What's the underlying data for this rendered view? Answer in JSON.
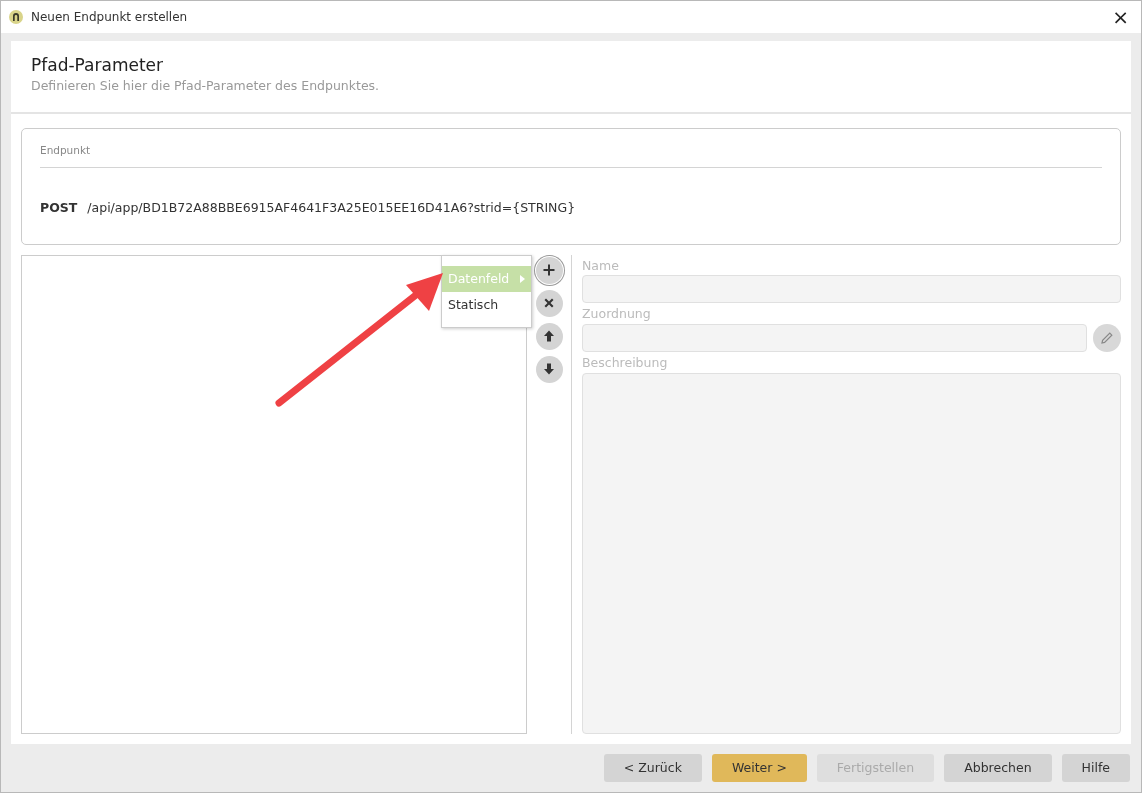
{
  "window": {
    "title": "Neuen Endpunkt erstellen",
    "close": "×"
  },
  "header": {
    "title": "Pfad-Parameter",
    "subtitle": "Definieren Sie hier die Pfad-Parameter des Endpunktes."
  },
  "endpoint": {
    "legend": "Endpunkt",
    "method": "POST",
    "path": "/api/app/BD1B72A88BBE6915AF4641F3A25E015EE16D41A6?strid={STRING}"
  },
  "menu": [
    {
      "label": "Datenfeld",
      "selected": true,
      "submenu": true
    },
    {
      "label": "Statisch",
      "selected": false,
      "submenu": false
    }
  ],
  "tools": [
    {
      "kind": "add",
      "focused": true
    },
    {
      "kind": "remove",
      "focused": false
    },
    {
      "kind": "up",
      "focused": false
    },
    {
      "kind": "down",
      "focused": false
    }
  ],
  "fields": [
    {
      "label": "Name",
      "kind": "text",
      "disabled": true
    },
    {
      "label": "Zuordnung",
      "kind": "edit",
      "disabled": true
    },
    {
      "label": "Beschreibung",
      "kind": "area",
      "disabled": true
    }
  ],
  "buttons": [
    {
      "label": "< Zurück",
      "kind": "default",
      "disabled": false
    },
    {
      "label": "Weiter >",
      "kind": "primary",
      "disabled": false
    },
    {
      "label": "Fertigstellen",
      "kind": "default",
      "disabled": true
    },
    {
      "label": "Abbrechen",
      "kind": "default",
      "disabled": false
    },
    {
      "label": "Hilfe",
      "kind": "default",
      "disabled": false
    }
  ]
}
